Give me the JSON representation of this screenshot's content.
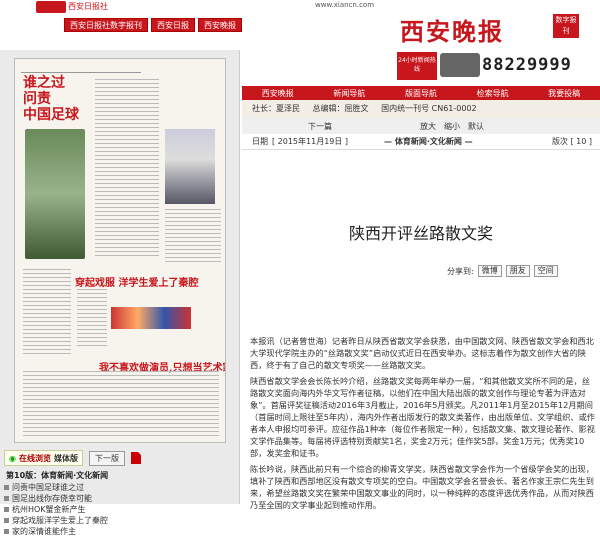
{
  "header": {
    "logo_text": "西安日报社",
    "tabs": [
      "西安日报社数字报刊",
      "西安日报",
      "西安晚报"
    ],
    "url": "www.xiancn.com",
    "brand": "西安晚报",
    "badge": "数字报刊"
  },
  "hotline": {
    "label": "24小时新闻热线",
    "number": "88229999"
  },
  "nav": [
    "西安晚报",
    "新闻导航",
    "版面导航",
    "检索导航",
    "我要投稿"
  ],
  "info": {
    "chief": "社长：夏泽民",
    "editor": "总编辑：屈胜文",
    "code": "国内统一刊号 CN61-0002"
  },
  "tools": {
    "prev": "下一篇",
    "zoom_in": "放大",
    "zoom_out": "缩小",
    "default": "默认"
  },
  "date": {
    "label": "日期",
    "value": "[ 2015年11月19日 ]",
    "edition": "— 体育新闻·文化新闻 —",
    "page_label": "版次",
    "page": "[ 10 ]"
  },
  "article": {
    "title": "陕西开评丝路散文奖",
    "share_label": "分享到:",
    "share": [
      "微博",
      "朋友",
      "空间"
    ],
    "paragraphs": [
      "本报讯（记者曾世海）记者昨日从陕西省散文学会获悉，由中国散文网、陕西省散文学会和西北大学现代学院主办的“丝路散文奖”启动仪式近日在西安举办。这标志着作为散文创作大省的陕西，终于有了自己的散文专项奖——丝路散文奖。",
      "陕西省散文学会会长陈长吟介绍，丝路散文奖每两年举办一届，“和其他散文奖所不同的是，丝路散文奖面向海内外华文写作者征稿，以他们在中国大陆出版的散文创作与理论专著为评选对象”。首届评奖征稿活动2016年3月截止，2016年5月颁奖。凡2011年1月至2015年12月期间（首届时间上限往至5年内），海内外作者出版发行的散文类著作，由出版单位、文学组织、或作者本人申报均可参评。应征作品1种本（每位作者限定一种），包括散文集、散文理论著作、影视文学作品集等。每届将评选特别贡献奖1名，奖金2万元；佳作奖5部，奖金1万元；优秀奖10部，发奖金和证书。",
      "陈长吟说，陕西此前只有一个综合的柳青文学奖，陕西省散文学会作为一个省级学会奖的出现，填补了陕西和西部地区没有散文专项奖的空白。中国散文学会名誉会长、著名作家王宗仁先生到来，希望丝路散文奖在繁荣中国散文事业的同时，以一种纯粹的态度评选优秀作品，从而对陕西乃至全国的文学事业起到推动作用。"
    ]
  },
  "left": {
    "online": "在线浏览",
    "media": "媒体版",
    "next": "下一版",
    "edition_title": "第10版：体育新闻·文化新闻",
    "articles": [
      "问责中国足球谁之过",
      "国足出线你存侥幸可能",
      "杭州HOK蟹金新产生",
      "穿起戏服洋学生爱上了秦腔",
      "家的深情谁能作主"
    ]
  }
}
